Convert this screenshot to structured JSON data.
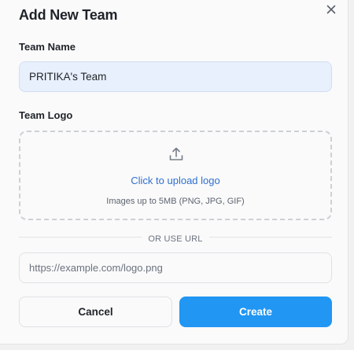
{
  "dialog": {
    "title": "Add New Team",
    "close_icon": "close-icon"
  },
  "team_name": {
    "label": "Team Name",
    "value": "PRITIKA's Team"
  },
  "team_logo": {
    "label": "Team Logo",
    "upload_icon": "upload-icon",
    "upload_text": "Click to upload logo",
    "hint": "Images up to 5MB (PNG, JPG, GIF)"
  },
  "divider": {
    "text": "OR USE URL"
  },
  "logo_url": {
    "placeholder": "https://example.com/logo.png",
    "value": ""
  },
  "actions": {
    "cancel_label": "Cancel",
    "create_label": "Create"
  },
  "colors": {
    "primary": "#2196f3",
    "link": "#2f6fd0",
    "input_fill": "#e8f0fd"
  }
}
